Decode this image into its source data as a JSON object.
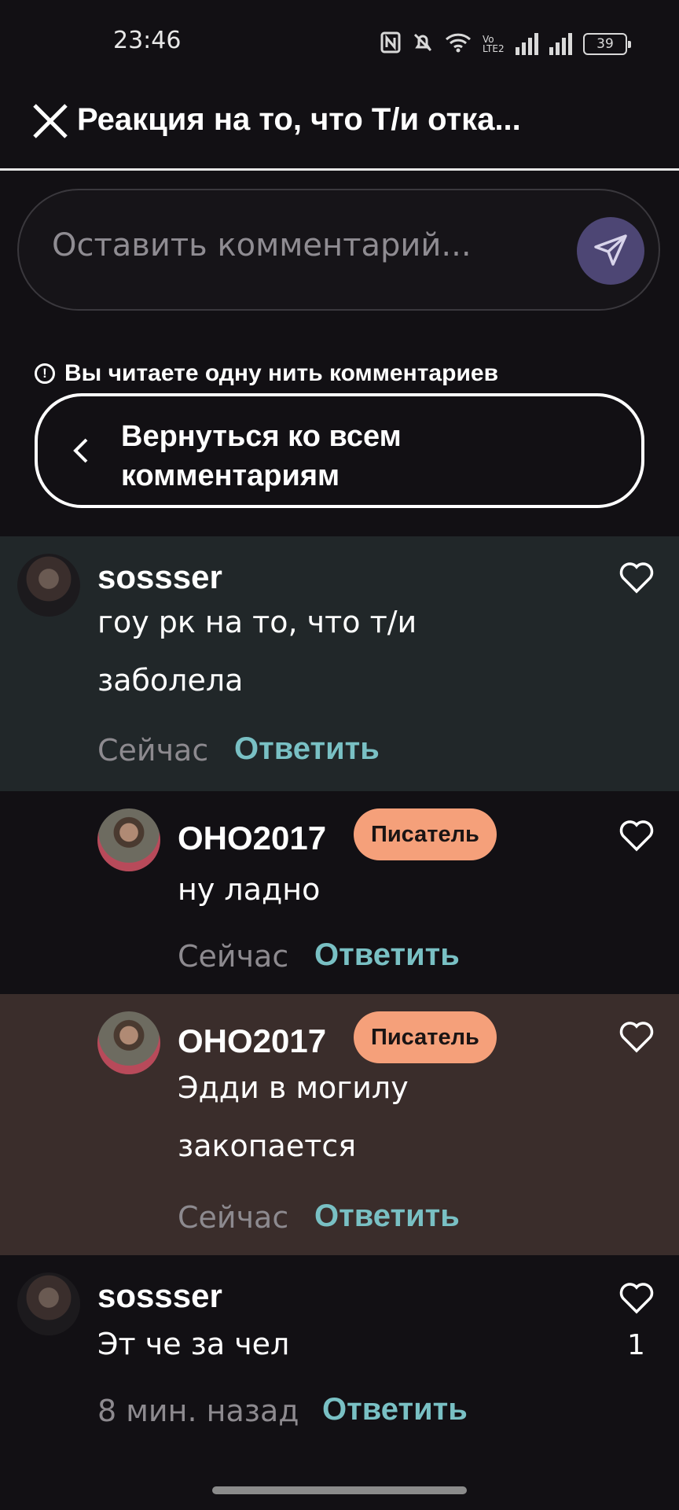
{
  "status_bar": {
    "time": "23:46",
    "battery": "39",
    "network_label": "Vo LTE2"
  },
  "header": {
    "title": "Реакция на то, что Т/и отка..."
  },
  "comment_input": {
    "placeholder": "Оставить комментарий..."
  },
  "thread": {
    "notice": "Вы читаете одну нить комментариев",
    "back_label": "Вернуться ко всем комментариям"
  },
  "comments": [
    {
      "username": "sossser",
      "text": "гоу рк на то, что т/и заболела",
      "time": "Сейчас",
      "reply_label": "Ответить",
      "badge": "",
      "background": "#212729"
    },
    {
      "username": "OHO2017",
      "text": "ну ладно",
      "time": "Сейчас",
      "reply_label": "Ответить",
      "badge": "Писатель",
      "background": "#121014"
    },
    {
      "username": "OHO2017",
      "text": "Эдди в могилу закопается",
      "time": "Сейчас",
      "reply_label": "Ответить",
      "badge": "Писатель",
      "background": "#3a2d2b"
    },
    {
      "username": "sossser",
      "text": "Эт че за чел",
      "time": "8 мин. назад",
      "reply_label": "Ответить",
      "badge": "",
      "like_count": "1",
      "background": "#121014"
    }
  ],
  "colors": {
    "accent_reply": "#79c0c4",
    "badge": "#f5a07a",
    "send_button": "#4d4674"
  }
}
